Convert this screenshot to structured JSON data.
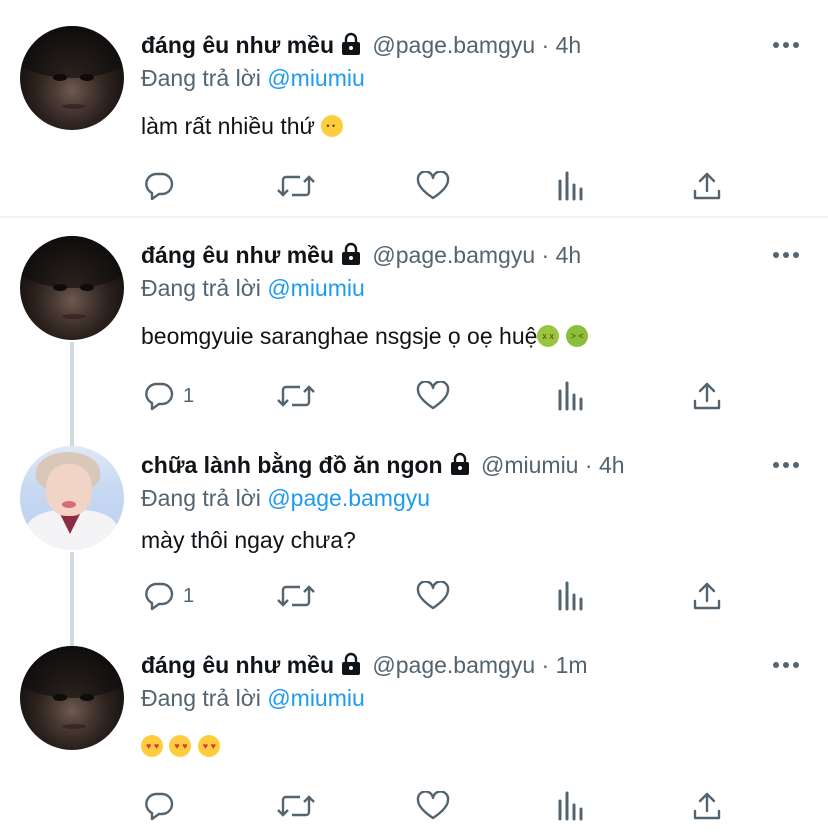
{
  "tweets": [
    {
      "name": "đáng êu như mều",
      "handle": "@page.bamgyu",
      "sep": "·",
      "time": "4h",
      "reply_prefix": "Đang trả lời",
      "reply_to": "@miumiu",
      "text": "làm rất nhiều thứ",
      "emojis": [
        "slightly-smiling-face"
      ],
      "reply_count": "",
      "avatar": "dark"
    },
    {
      "name": "đáng êu như mều",
      "handle": "@page.bamgyu",
      "sep": "·",
      "time": "4h",
      "reply_prefix": "Đang trả lời",
      "reply_to": "@miumiu",
      "text": "beomgyuie saranghae nsgsje ọ oẹ huệ",
      "emojis": [
        "nauseated-face",
        "vomiting-face"
      ],
      "reply_count": "1",
      "avatar": "dark"
    },
    {
      "name": "chữa lành bằng đồ ăn ngon",
      "handle": "@miumiu",
      "sep": "·",
      "time": "4h",
      "reply_prefix": "Đang trả lời",
      "reply_to": "@page.bamgyu",
      "text": "mày thôi ngay chưa?",
      "emojis": [],
      "reply_count": "1",
      "avatar": "light"
    },
    {
      "name": "đáng êu như mều",
      "handle": "@page.bamgyu",
      "sep": "·",
      "time": "1m",
      "reply_prefix": "Đang trả lời",
      "reply_to": "@miumiu",
      "text": "",
      "emojis": [
        "smiling-face-with-hearts",
        "smiling-face-with-hearts",
        "smiling-face-with-hearts"
      ],
      "reply_count": "",
      "avatar": "dark"
    }
  ],
  "icons": {
    "lock": "lock-icon",
    "more": "more-dots-icon",
    "reply": "reply-bubble-icon",
    "retweet": "retweet-icon",
    "like": "heart-icon",
    "analytics": "analytics-bars-icon",
    "share": "share-upload-icon"
  },
  "colors": {
    "text": "#0f1419",
    "muted": "#536471",
    "mention": "#1d9bf0",
    "divider": "#eff3f4",
    "thread_line": "#cfd9de"
  }
}
